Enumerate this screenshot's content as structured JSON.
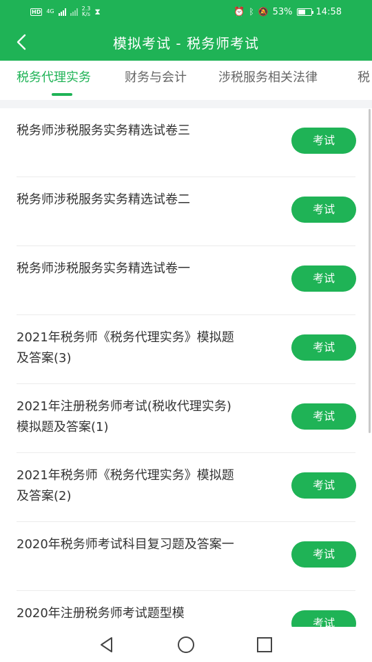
{
  "status_bar": {
    "hd_label": "HD",
    "network_label": "4G",
    "speed_value": "2.3",
    "speed_unit": "K/s",
    "battery_text": "53%",
    "battery_level": 0.53,
    "time": "14:58",
    "icons": [
      "hd-icon",
      "signal-icon",
      "hourglass-icon",
      "alarm-icon",
      "bluetooth-icon",
      "mute-icon",
      "battery-icon"
    ]
  },
  "app_bar": {
    "title": "模拟考试 - 税务师考试",
    "back_icon": "back-arrow-icon"
  },
  "tabs": [
    {
      "label": "税务代理实务",
      "active": true
    },
    {
      "label": "财务与会计",
      "active": false
    },
    {
      "label": "涉税服务相关法律",
      "active": false
    },
    {
      "label": "税",
      "active": false
    }
  ],
  "colors": {
    "accent": "#1fb356",
    "text": "#333333",
    "tab_inactive": "#666666"
  },
  "exam_button_label": "考试",
  "list": [
    {
      "title": "税务师涉税服务实务精选试卷三"
    },
    {
      "title": "税务师涉税服务实务精选试卷二"
    },
    {
      "title": "税务师涉税服务实务精选试卷一"
    },
    {
      "title": "2021年税务师《税务代理实务》模拟题及答案(3)"
    },
    {
      "title": "2021年注册税务师考试(税收代理实务)模拟题及答案(1)"
    },
    {
      "title": "2021年税务师《税务代理实务》模拟题及答案(2)"
    },
    {
      "title": "2020年税务师考试科目复习题及答案一"
    },
    {
      "title": "2020年注册税务师考试题型模"
    }
  ],
  "nav_bar": {
    "icons": [
      "back-triangle-icon",
      "home-circle-icon",
      "recents-square-icon"
    ]
  }
}
